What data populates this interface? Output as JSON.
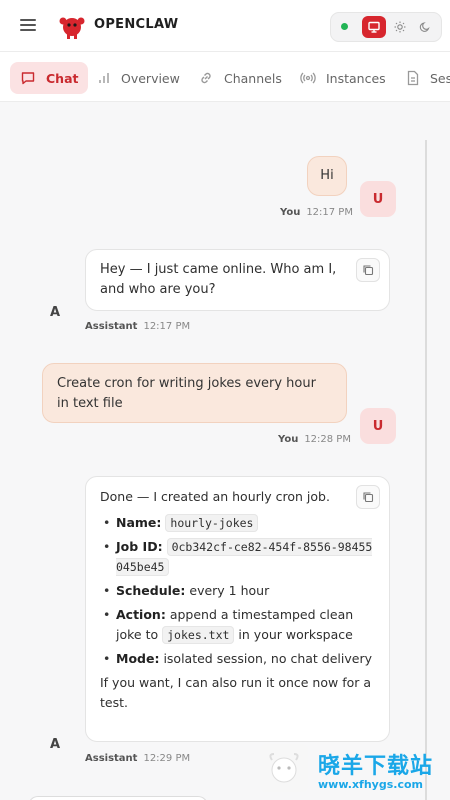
{
  "header": {
    "app_name": "OPENCLAW",
    "accent_color": "#d7262e",
    "status_color": "#22b455",
    "theme_modes": [
      "monitor-icon",
      "sun-icon",
      "moon-icon"
    ],
    "active_theme": "monitor-icon"
  },
  "tabs": [
    {
      "label": "Chat",
      "icon": "chat-icon",
      "active": true
    },
    {
      "label": "Overview",
      "icon": "bar-chart-icon"
    },
    {
      "label": "Channels",
      "icon": "link-icon"
    },
    {
      "label": "Instances",
      "icon": "radio-signal-icon"
    },
    {
      "label": "Ses",
      "icon": "document-icon"
    }
  ],
  "messages": [
    {
      "role": "user",
      "text": "Hi",
      "sender": "You",
      "time": "12:17 PM",
      "avatar": "U"
    },
    {
      "role": "assistant",
      "text": "Hey — I just came online. Who am I, and who are you?",
      "sender": "Assistant",
      "time": "12:17 PM",
      "avatar": "A"
    },
    {
      "role": "user",
      "text": "Create cron for writing jokes every hour in text file",
      "sender": "You",
      "time": "12:28 PM",
      "avatar": "U"
    },
    {
      "role": "assistant",
      "intro": "Done — I created an hourly cron job.",
      "details": {
        "name_label": "Name:",
        "name_value": "hourly-jokes",
        "jobid_label": "Job ID:",
        "jobid_value": "0cb342cf-ce82-454f-8556-98455045be45",
        "schedule_label": "Schedule:",
        "schedule_value": "every 1 hour",
        "action_label": "Action:",
        "action_pre": "append a timestamped clean joke to",
        "action_code": "jokes.txt",
        "action_post": "in your workspace",
        "mode_label": "Mode:",
        "mode_value": "isolated session, no chat delivery"
      },
      "outro": "If you want, I can also run it once now for a test.",
      "sender": "Assistant",
      "time": "12:29 PM",
      "avatar": "A"
    }
  ],
  "watermark": {
    "title": "晓羊下载站",
    "url": "www.xfhygs.com"
  }
}
